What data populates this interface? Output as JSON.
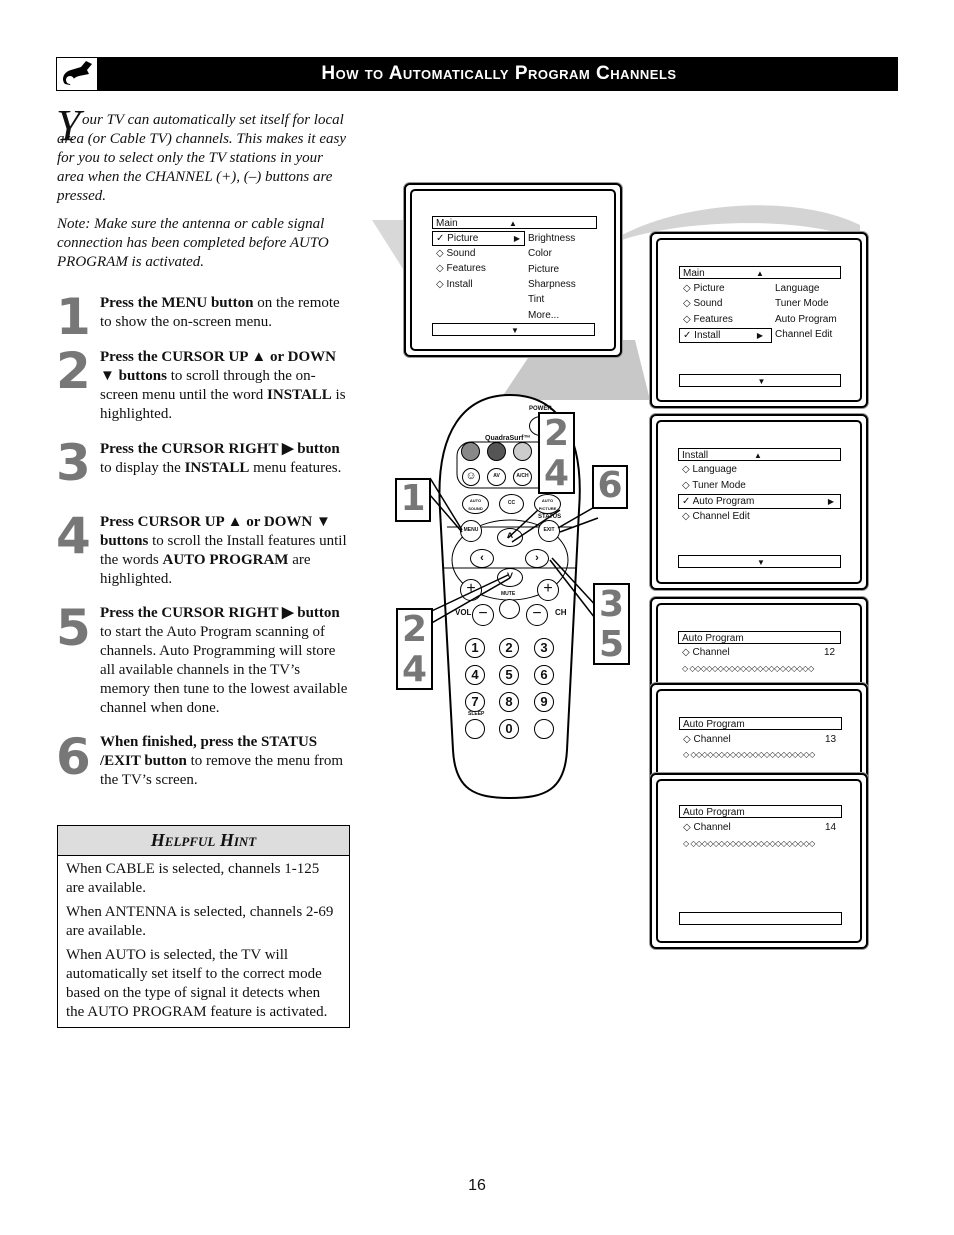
{
  "header": {
    "title": "How to Automatically Program Channels",
    "icon": "wrench-icon"
  },
  "intro": {
    "dropcap": "Y",
    "paragraph_rest": "our TV can automatically set itself for local area (or Cable TV) channels. This makes it easy for you to select only the TV stations in your area when the CHANNEL (+), (–) buttons are pressed.",
    "note": "Note: Make sure the antenna or cable signal connection has been completed before AUTO PROGRAM is activated."
  },
  "steps": [
    {
      "number": "1",
      "bold": "Press the MENU button",
      "text": " on the remote to show the on-screen menu."
    },
    {
      "number": "2",
      "bold": "Press the CURSOR UP ▲ or DOWN ▼ buttons",
      "text": " to scroll through the on-screen menu until the word ",
      "bold2": "INSTALL",
      "text2": " is highlighted."
    },
    {
      "number": "3",
      "bold": "Press the CURSOR RIGHT ▶ button",
      "text": " to display the ",
      "bold2": "INSTALL",
      "text2": " menu features."
    },
    {
      "number": "4",
      "bold": "Press CURSOR UP ▲ or DOWN ▼ buttons",
      "text": " to scroll the Install features until the words ",
      "bold2": "AUTO PROGRAM",
      "text2": " are highlighted."
    },
    {
      "number": "5",
      "bold": "Press the CURSOR RIGHT ▶ button",
      "text": " to start the Auto Program scanning of channels. Auto Programming will store all available channels in the TV’s memory then tune to the lowest available channel when done."
    },
    {
      "number": "6",
      "bold": "When finished, press the STATUS /EXIT button",
      "text": " to remove the menu from the TV’s screen."
    }
  ],
  "hint": {
    "title": "Helpful Hint",
    "paragraphs": [
      "When CABLE is selected, channels 1-125 are available.",
      "When ANTENNA is selected, channels 2-69 are available.",
      "When AUTO is selected, the TV will automatically set itself to the correct mode based on the type of signal it detects when the AUTO PROGRAM feature is activated."
    ]
  },
  "screens": {
    "main_picture": {
      "title": "Main",
      "left_items": [
        "Picture",
        "Sound",
        "Features",
        "Install"
      ],
      "selected": "Picture",
      "right_items": [
        "Brightness",
        "Color",
        "Picture",
        "Sharpness",
        "Tint",
        "More..."
      ]
    },
    "main_install": {
      "title": "Main",
      "left_items": [
        "Picture",
        "Sound",
        "Features",
        "Install"
      ],
      "selected": "Install",
      "right_items": [
        "Language",
        "Tuner Mode",
        "Auto Program",
        "Channel Edit"
      ]
    },
    "install_menu": {
      "title": "Install",
      "items": [
        "Language",
        "Tuner Mode",
        "Auto Program",
        "Channel Edit"
      ],
      "selected": "Auto Program"
    },
    "auto_program": [
      {
        "title": "Auto Program",
        "label": "Channel",
        "value": "12"
      },
      {
        "title": "Auto Program",
        "label": "Channel",
        "value": "13"
      },
      {
        "title": "Auto Program",
        "label": "Channel",
        "value": "14"
      }
    ],
    "progress_dots": "◇ ◇◇◇◇◇◇◇◇◇◇◇◇◇◇◇◇◇◇◇◇◇◇"
  },
  "remote": {
    "labels": {
      "power": "POWER",
      "quadrasurf": "QuadraSurf™",
      "av": "AV",
      "ach": "A/CH",
      "auto_sound": "AUTO SOUND",
      "cc": "CC",
      "auto_picture": "AUTO PICTURE",
      "menu": "MENU",
      "status": "STATUS",
      "exit": "EXIT",
      "mute": "MUTE",
      "vol": "VOL",
      "ch": "CH",
      "sleep": "SLEEP"
    },
    "digits": [
      "1",
      "2",
      "3",
      "4",
      "5",
      "6",
      "7",
      "8",
      "9",
      "0"
    ],
    "callouts": {
      "menu": "1",
      "up": "2\n4",
      "exit": "6",
      "right": "3\n5",
      "down": "2\n4"
    }
  },
  "footer": {
    "page_number": "16"
  }
}
